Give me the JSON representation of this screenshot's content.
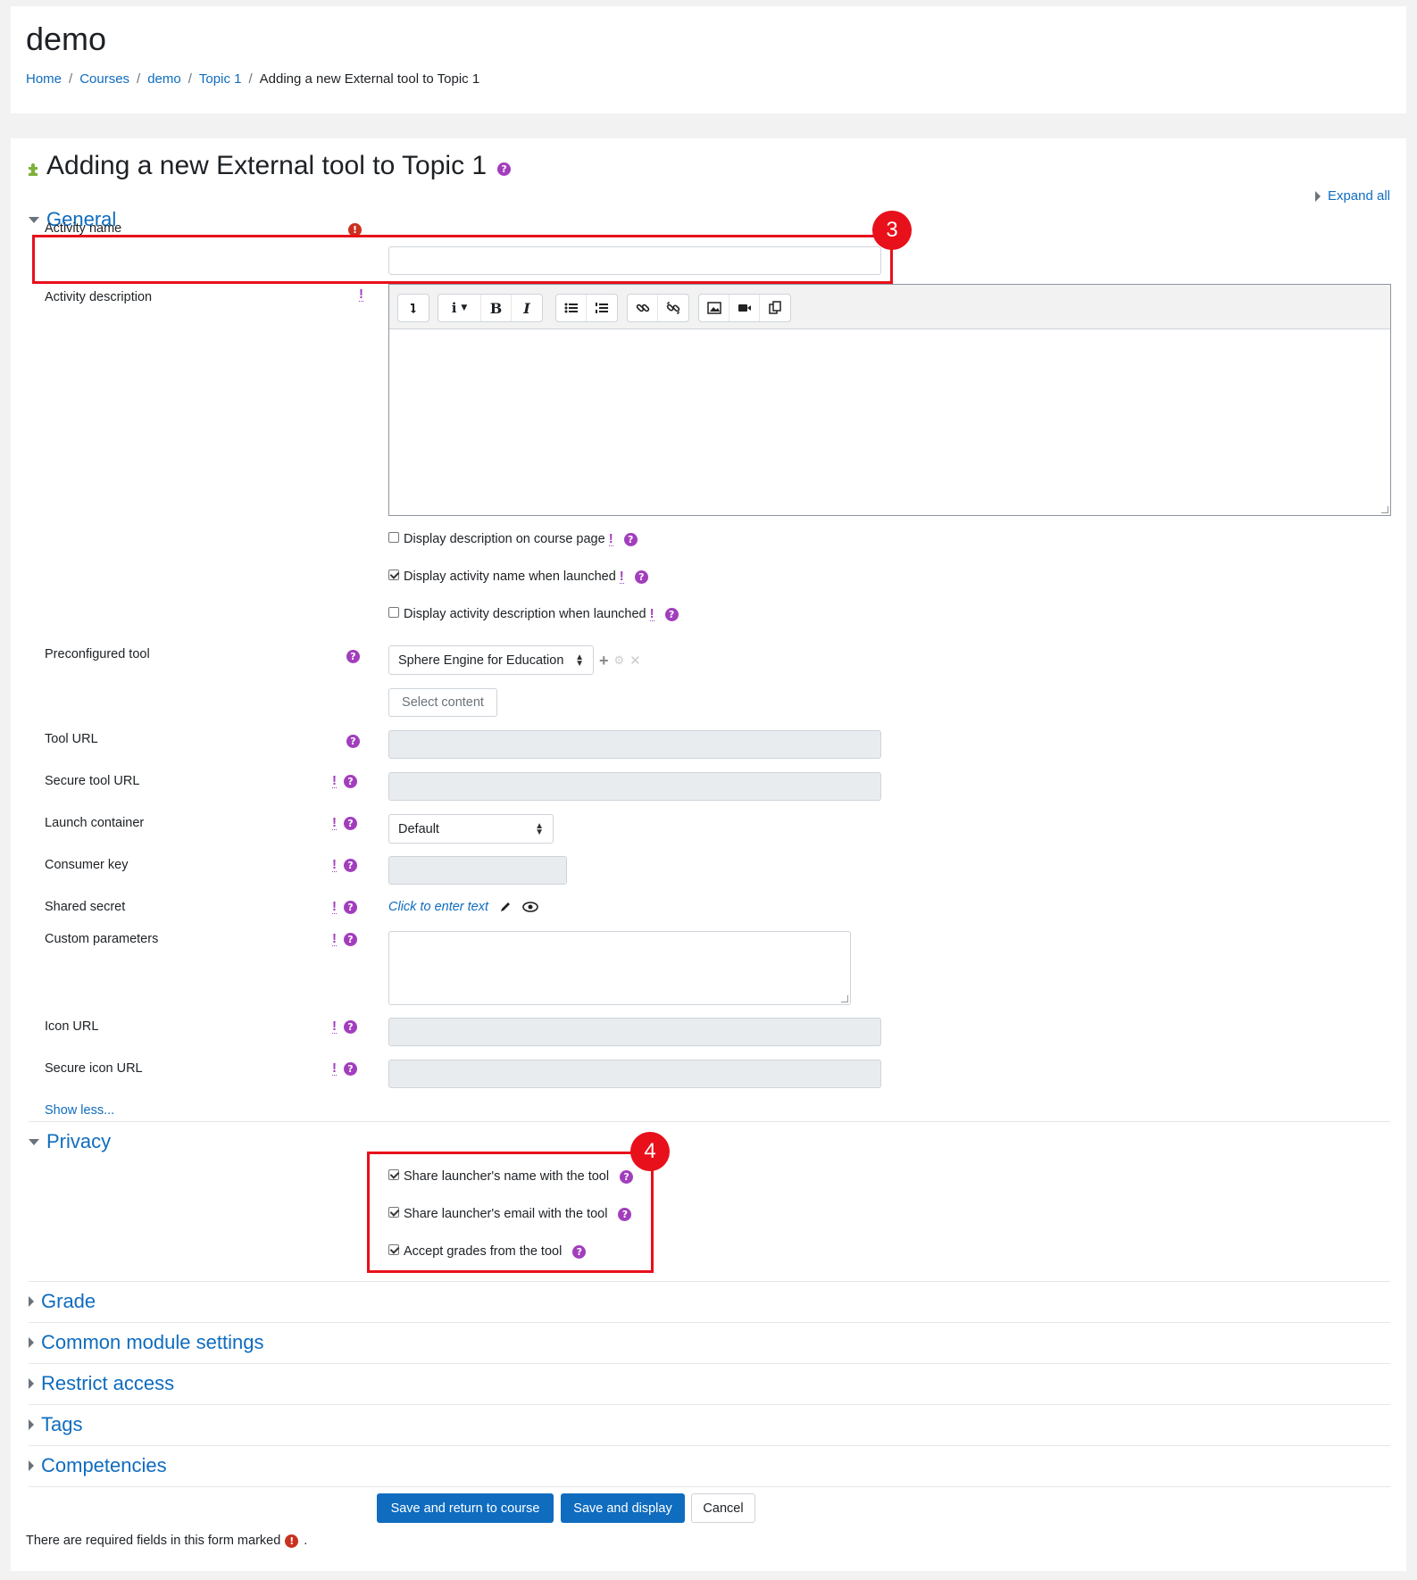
{
  "header": {
    "course_title": "demo",
    "breadcrumb": [
      "Home",
      "Courses",
      "demo",
      "Topic 1"
    ],
    "breadcrumb_separator": "/",
    "breadcrumb_current": "Adding a new External tool to Topic 1"
  },
  "page": {
    "heading": "Adding a new External tool to Topic 1",
    "expand_all": "Expand all"
  },
  "sections": {
    "general": "General",
    "privacy": "Privacy",
    "collapsed": [
      "Grade",
      "Common module settings",
      "Restrict access",
      "Tags",
      "Competencies"
    ]
  },
  "general": {
    "activity_name_label": "Activity name",
    "activity_name_value": "",
    "activity_description_label": "Activity description",
    "editor_toolbar_icons": [
      "collapse-icon",
      "info-style-icon",
      "bold-icon",
      "italic-icon",
      "unordered-list-icon",
      "ordered-list-icon",
      "link-icon",
      "unlink-icon",
      "image-icon",
      "video-icon",
      "manage-files-icon"
    ],
    "bold_glyph": "B",
    "italic_glyph": "I",
    "checkboxes": [
      {
        "label": "Display description on course page",
        "checked": false
      },
      {
        "label": "Display activity name when launched",
        "checked": true
      },
      {
        "label": "Display activity description when launched",
        "checked": false
      }
    ],
    "preconfigured_tool_label": "Preconfigured tool",
    "preconfigured_tool_value": "Sphere Engine for Education",
    "select_content_label": "Select content",
    "tool_url_label": "Tool URL",
    "secure_tool_url_label": "Secure tool URL",
    "launch_container_label": "Launch container",
    "launch_container_value": "Default",
    "consumer_key_label": "Consumer key",
    "shared_secret_label": "Shared secret",
    "shared_secret_placeholder": "Click to enter text",
    "custom_parameters_label": "Custom parameters",
    "icon_url_label": "Icon URL",
    "secure_icon_url_label": "Secure icon URL",
    "show_less": "Show less..."
  },
  "privacy": {
    "checkboxes": [
      {
        "label": "Share launcher's name with the tool",
        "checked": true
      },
      {
        "label": "Share launcher's email with the tool",
        "checked": true
      },
      {
        "label": "Accept grades from the tool",
        "checked": true
      }
    ]
  },
  "annotations": {
    "box_3": "3",
    "box_4": "4",
    "color": "#e8101a"
  },
  "buttons": {
    "save_return": "Save and return to course",
    "save_display": "Save and display",
    "cancel": "Cancel"
  },
  "footer": {
    "required_note": "There are required fields in this form marked",
    "required_period": "."
  },
  "colors": {
    "link": "#0f6cbf",
    "help": "#a23ebd",
    "required": "#ca3120",
    "primary_button": "#0f6cbf"
  }
}
